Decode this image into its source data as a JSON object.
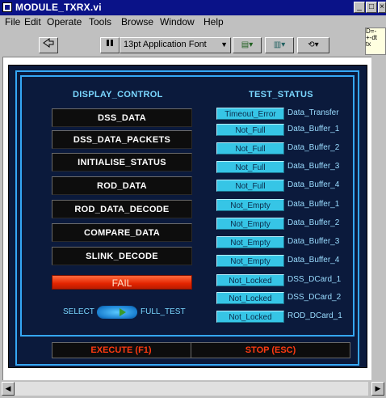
{
  "window": {
    "title": "MODULE_TXRX.vi"
  },
  "menu": [
    "File",
    "Edit",
    "Operate",
    "Tools",
    "Browse",
    "Window",
    "Help"
  ],
  "toolbar": {
    "font_label": "13pt Application Font"
  },
  "help_text": "D=-\n+-dt\ntx",
  "panel": {
    "display_header": "DISPLAY_CONTROL",
    "status_header": "TEST_STATUS",
    "display_buttons": [
      "DSS_DATA",
      "DSS_DATA_PACKETS",
      "INITIALISE_STATUS",
      "ROD_DATA",
      "ROD_DATA_DECODE",
      "COMPARE_DATA",
      "SLINK_DECODE"
    ],
    "fail_label": "FAIL",
    "select_label": "SELECT",
    "full_test_label": "FULL_TEST",
    "statuses": [
      {
        "value": "Timeout_Error",
        "label": "Data_Transfer"
      },
      {
        "value": "Not_Full",
        "label": "Data_Buffer_1"
      },
      {
        "value": "Not_Full",
        "label": "Data_Buffer_2"
      },
      {
        "value": "Not_Full",
        "label": "Data_Buffer_3"
      },
      {
        "value": "Not_Full",
        "label": "Data_Buffer_4"
      },
      {
        "value": "Not_Empty",
        "label": "Data_Buffer_1"
      },
      {
        "value": "Not_Empty",
        "label": "Data_Buffer_2"
      },
      {
        "value": "Not_Empty",
        "label": "Data_Buffer_3"
      },
      {
        "value": "Not_Empty",
        "label": "Data_Buffer_4"
      },
      {
        "value": "Not_Locked",
        "label": "DSS_DCard_1"
      },
      {
        "value": "Not_Locked",
        "label": "DSS_DCard_2"
      },
      {
        "value": "Not_Locked",
        "label": "ROD_DCard_1"
      }
    ],
    "execute_label": "EXECUTE (F1)",
    "stop_label": "STOP (ESC)"
  },
  "colors": {
    "panel_bg": "#0b1a3c",
    "frame": "#35a7f5",
    "status": "#36c5e6",
    "fail": "#e22400",
    "action_text": "#ff3a10"
  }
}
